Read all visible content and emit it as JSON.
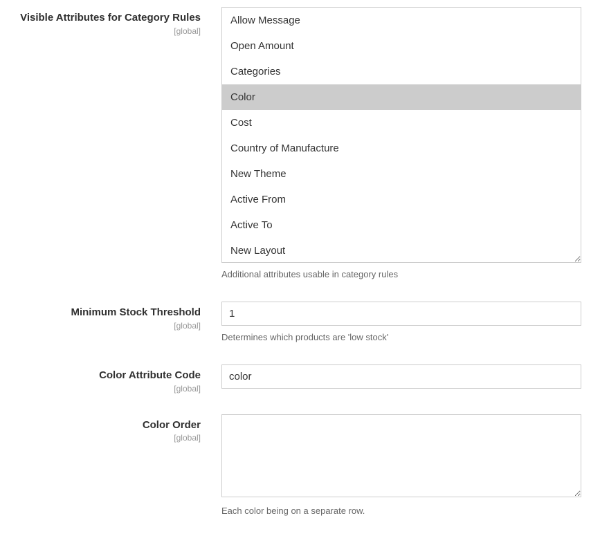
{
  "fields": {
    "visible_attributes": {
      "label": "Visible Attributes for Category Rules",
      "scope": "[global]",
      "note": "Additional attributes usable in category rules",
      "options": [
        {
          "label": "Allow Message",
          "selected": false
        },
        {
          "label": "Open Amount",
          "selected": false
        },
        {
          "label": "Categories",
          "selected": false
        },
        {
          "label": "Color",
          "selected": true
        },
        {
          "label": "Cost",
          "selected": false
        },
        {
          "label": "Country of Manufacture",
          "selected": false
        },
        {
          "label": "New Theme",
          "selected": false
        },
        {
          "label": "Active From",
          "selected": false
        },
        {
          "label": "Active To",
          "selected": false
        },
        {
          "label": "New Layout",
          "selected": false
        }
      ]
    },
    "min_stock": {
      "label": "Minimum Stock Threshold",
      "scope": "[global]",
      "value": "1",
      "note": "Determines which products are 'low stock'"
    },
    "color_attr": {
      "label": "Color Attribute Code",
      "scope": "[global]",
      "value": "color"
    },
    "color_order": {
      "label": "Color Order",
      "scope": "[global]",
      "value": "",
      "note": "Each color being on a separate row."
    }
  }
}
